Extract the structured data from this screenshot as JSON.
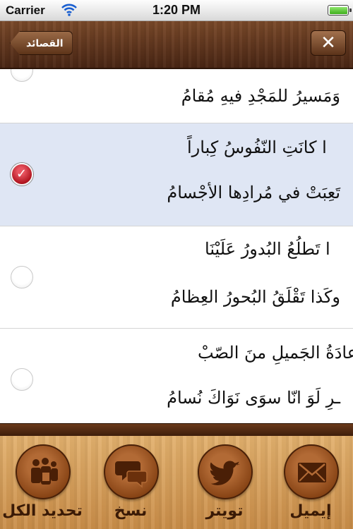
{
  "status_bar": {
    "carrier": "Carrier",
    "time": "1:20 PM"
  },
  "nav": {
    "back_label": "القصائد",
    "close_icon": "close-icon"
  },
  "verses": [
    {
      "line": "وَمَسيرُ للمَجْدِ فيهِ مُقامُ",
      "selected": false
    },
    {
      "line": "ا كانَتِ النّفُوسُ كِباراً",
      "selected": true
    },
    {
      "line": "تَعِبَتْ في مُرادِها الأجْسامُ",
      "selected": true
    },
    {
      "line": "ا تَطلُعُ البُدورُ عَلَيْنَا",
      "selected": false
    },
    {
      "line": "وكَذا تَقْلَقُ البُحورُ العِظامُ",
      "selected": false
    },
    {
      "line": "عادَةُ الجَميلِ منَ الصّبْ",
      "selected": false
    },
    {
      "line": "ـرِ لَوَ انّا سوَى نَوَاكَ نُسامُ",
      "selected": false
    }
  ],
  "toolbar": {
    "select_all": "تحديد الكل",
    "copy": "نسخ",
    "twitter": "تويتر",
    "email": "إيميل"
  }
}
